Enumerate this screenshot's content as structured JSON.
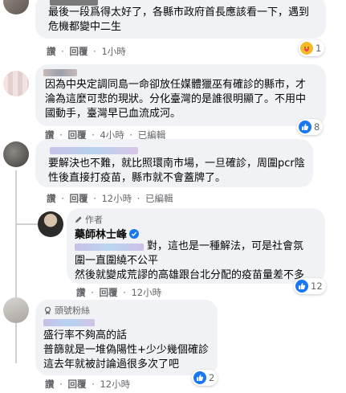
{
  "comments": [
    {
      "lines": [
        "最後一段爲得太好了，各縣市政府首長應該看一下，遇到",
        "危機都變中二生"
      ],
      "actions": {
        "like": "讚",
        "sep": "·",
        "reply": "回覆",
        "time": "1小時"
      },
      "reaction": {
        "icon": "care-icon",
        "count": "1"
      }
    },
    {
      "lines": [
        "因為中央定調同島一命卻放任媒體獵巫有確診的縣市，才",
        "淪為這麼可悲的現狀。分化臺灣的是誰很明顯了。不用中",
        "國動手，臺灣早已血流成河。"
      ],
      "actions": {
        "like": "讚",
        "sep": "·",
        "reply": "回覆",
        "time": "4小時",
        "edited": "已編輯"
      },
      "reaction": {
        "icon": "like-icon",
        "count": "8"
      }
    },
    {
      "lines": [
        "要解決也不難，就比照環南市場，一旦確診，周圍pcr陰",
        "性後直接打疫苗，縣市就不會蓋牌了。"
      ],
      "actions": {
        "like": "讚",
        "sep": "·",
        "reply": "回覆",
        "time": "12小時",
        "edited": "已編輯"
      }
    },
    {
      "author_badge": "作者",
      "author": "藥師林士峰",
      "lines": [
        "對，這也是一種解法，可是社會氛",
        "圍一直圍繞不公平",
        "然後就變成荒謬的高雄跟台北分配的疫苗量差不多"
      ],
      "actions": {
        "like": "讚",
        "sep": "·",
        "reply": "回覆",
        "time": "12小時"
      },
      "reaction": {
        "icon": "like-icon",
        "count": "12"
      }
    },
    {
      "fan_badge": "頭號粉絲",
      "lines": [
        "盛行率不夠高的話",
        "普篩就是一堆偽陽性+少少幾個確診",
        "這去年就被討論過很多次了吧"
      ],
      "actions": {
        "like": "讚",
        "sep": "·",
        "reply": "回覆",
        "time": "12小時"
      },
      "reaction": {
        "icon": "like-icon",
        "count": "2"
      }
    }
  ],
  "colors": {
    "bubble": "#f0f2f5",
    "meta_text": "#65676b",
    "like_blue": "#1877f2",
    "care_yellow": "#f7b928",
    "care_heart": "#f33e58"
  }
}
